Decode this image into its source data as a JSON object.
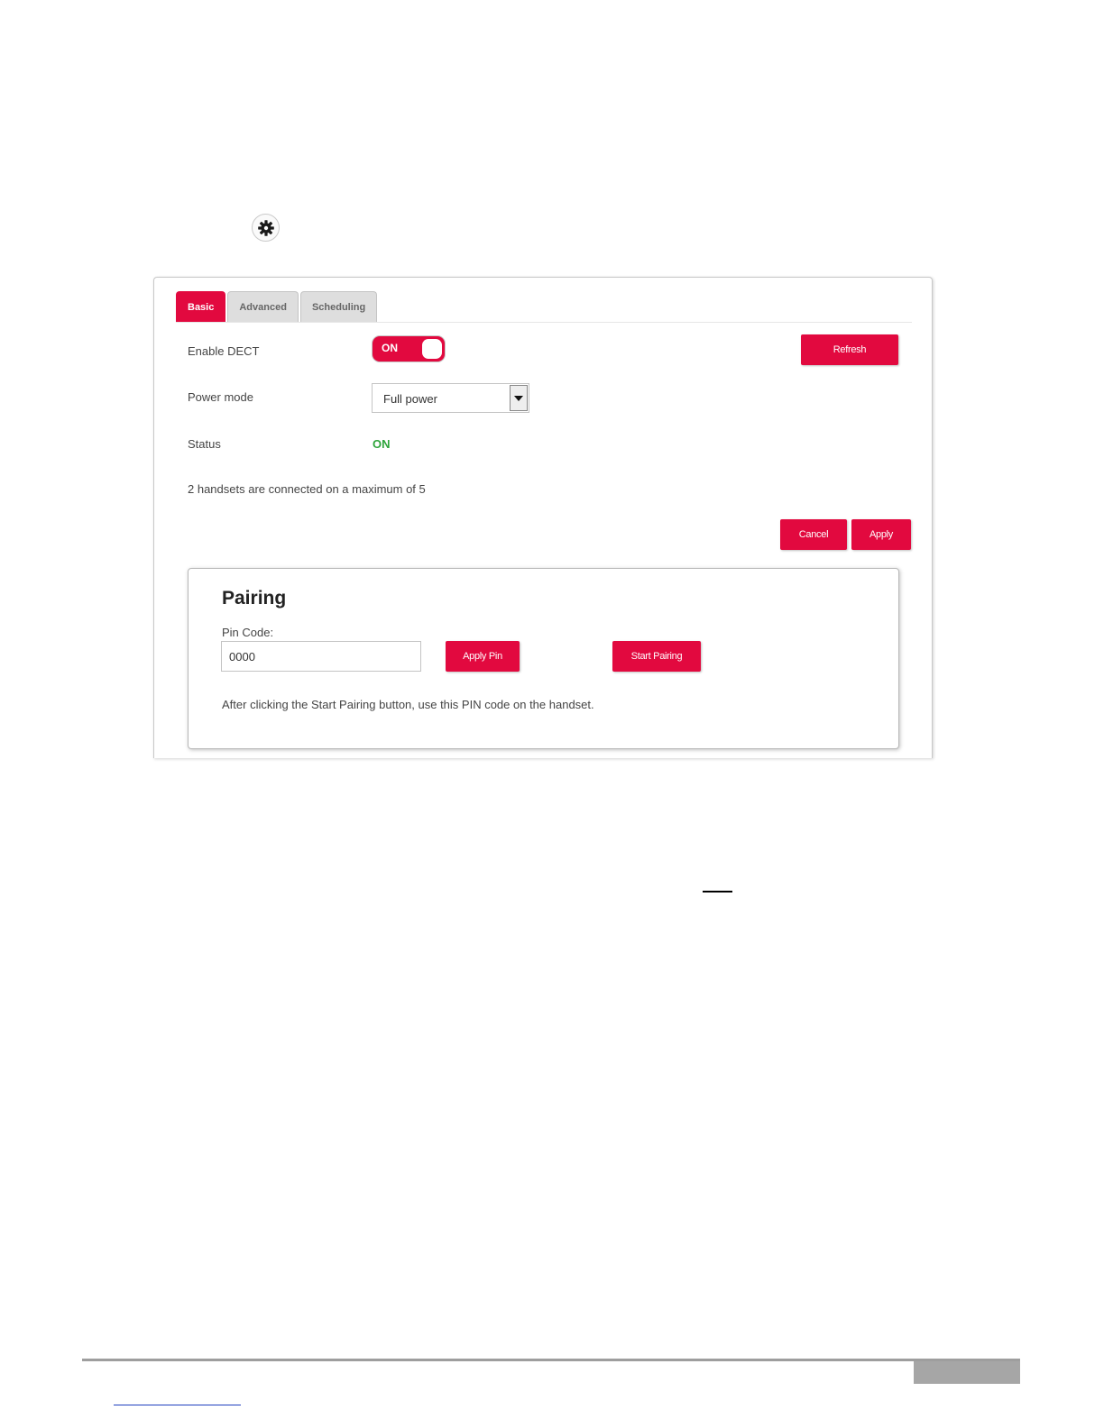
{
  "header": {
    "settings_icon": "gear-icon"
  },
  "tabs": [
    {
      "label": "Basic",
      "active": true
    },
    {
      "label": "Advanced",
      "active": false
    },
    {
      "label": "Scheduling",
      "active": false
    }
  ],
  "form": {
    "enable_dect_label": "Enable DECT",
    "enable_dect_toggle": "ON",
    "power_mode_label": "Power mode",
    "power_mode_value": "Full power",
    "status_label": "Status",
    "status_value": "ON",
    "handsets_text": "2  handsets are connected on a maximum of 5"
  },
  "buttons": {
    "refresh": "Refresh",
    "cancel": "Cancel",
    "apply": "Apply"
  },
  "pairing": {
    "title": "Pairing",
    "pin_label": "Pin Code:",
    "pin_value": "0000",
    "apply_pin": "Apply Pin",
    "start_pairing": "Start Pairing",
    "hint": "After clicking the Start Pairing button, use this PIN code on the handset."
  },
  "colors": {
    "accent": "#e2093f",
    "status_on": "#2ea43b"
  }
}
